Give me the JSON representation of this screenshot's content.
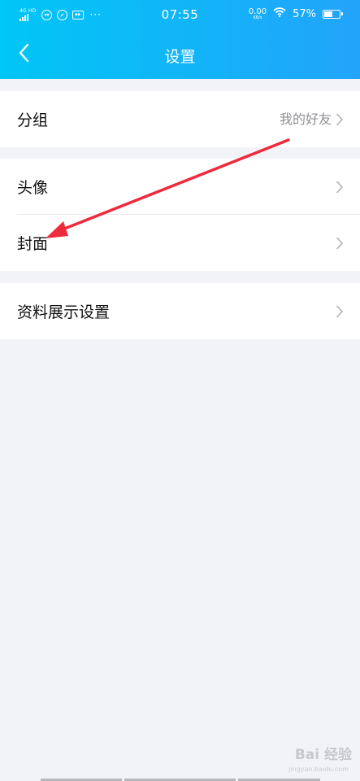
{
  "status_bar": {
    "network": "4G HD",
    "time": "07:55",
    "speed": "0.00",
    "speed_unit": "KB/s",
    "battery_percent": "57%",
    "battery_level": 0.57,
    "more": "···"
  },
  "header": {
    "title": "设置",
    "background_colors": [
      "#00c6f5",
      "#22a4fb"
    ]
  },
  "settings": {
    "group1": {
      "items": [
        {
          "label": "分组",
          "value": "我的好友"
        }
      ]
    },
    "group2": {
      "items": [
        {
          "label": "头像"
        },
        {
          "label": "封面"
        }
      ]
    },
    "group3": {
      "items": [
        {
          "label": "资料展示设置"
        }
      ]
    }
  },
  "annotation": {
    "color": "#ee2a3c"
  },
  "watermark": {
    "text": "Bai 经验",
    "sub": "jingyan.baidu.com"
  },
  "icons": {
    "back": "chevron-left-icon",
    "row_arrow": "chevron-right-icon",
    "wifi": "wifi-icon",
    "battery": "battery-icon",
    "signal": "signal-icon"
  }
}
